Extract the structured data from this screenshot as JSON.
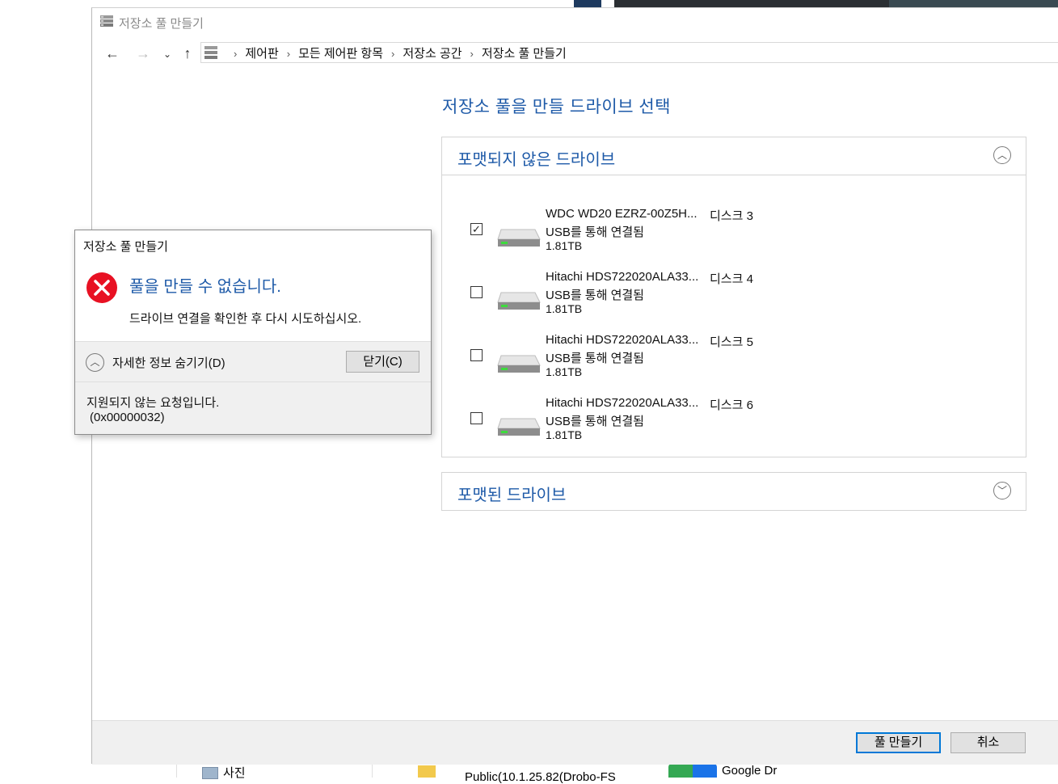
{
  "window": {
    "title": "저장소 풀 만들기"
  },
  "nav": {
    "back_icon": "←",
    "forward_icon": "→",
    "recent_icon": "⌄",
    "up_icon": "↑",
    "breadcrumbs": [
      "제어판",
      "모든 제어판 항목",
      "저장소 공간",
      "저장소 풀 만들기"
    ]
  },
  "page": {
    "heading": "저장소 풀을 만들 드라이브 선택"
  },
  "unformatted_group": {
    "title": "포맷되지 않은 드라이브",
    "expanded": true,
    "drives": [
      {
        "name": "WDC WD20 EZRZ-00Z5H...",
        "connection": "USB를 통해 연결됨",
        "size": "1.81TB",
        "disk": "디스크 3",
        "checked": true
      },
      {
        "name": "Hitachi HDS722020ALA33...",
        "connection": "USB를 통해 연결됨",
        "size": "1.81TB",
        "disk": "디스크 4",
        "checked": false
      },
      {
        "name": "Hitachi HDS722020ALA33...",
        "connection": "USB를 통해 연결됨",
        "size": "1.81TB",
        "disk": "디스크 5",
        "checked": false
      },
      {
        "name": "Hitachi HDS722020ALA33...",
        "connection": "USB를 통해 연결됨",
        "size": "1.81TB",
        "disk": "디스크 6",
        "checked": false
      }
    ]
  },
  "formatted_group": {
    "title": "포맷된 드라이브",
    "expanded": false
  },
  "footer": {
    "create_label": "풀 만들기",
    "cancel_label": "취소"
  },
  "error_dialog": {
    "title": "저장소 풀 만들기",
    "main_message": "풀을 만들 수 없습니다.",
    "sub_message": "드라이브 연결을 확인한 후 다시 시도하십시오.",
    "details_toggle": "자세한 정보 숨기기(D)",
    "close_label": "닫기(C)",
    "detail_message": "지원되지 않는 요청입니다.",
    "error_code": "(0x00000032)"
  },
  "background": {
    "taskbar_items": [
      "사진",
      "Public(10.1.25.82(Drobo-FS",
      "Google Dr"
    ]
  },
  "colors": {
    "accent_blue": "#1e5aa8",
    "primary_button_border": "#0078d7",
    "error_red": "#e81123"
  }
}
